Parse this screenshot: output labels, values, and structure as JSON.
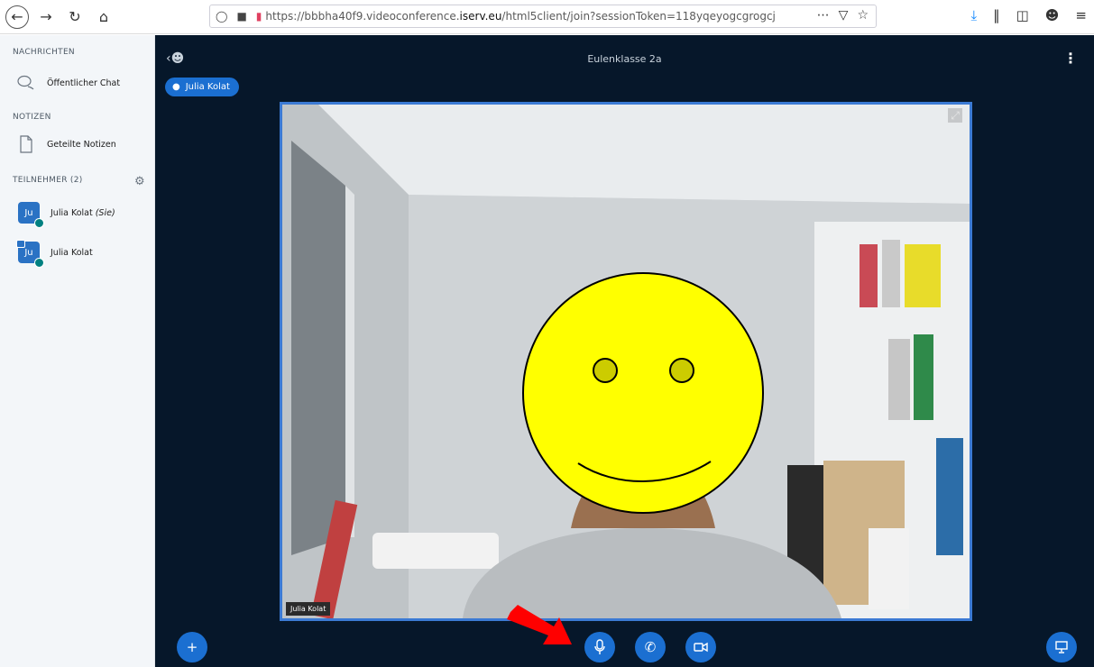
{
  "browser": {
    "url_prefix": "https://bbbha40f9.videoconference.",
    "url_domain": "iserv.eu",
    "url_suffix": "/html5client/join?sessionToken=118yqeyogcgrogcj",
    "icons": [
      "back-icon",
      "forward-icon",
      "reload-icon",
      "home-icon",
      "shield-icon",
      "lock-icon",
      "camera-permission-icon",
      "more-icon",
      "pocket-icon",
      "bookmark-star-icon",
      "download-icon",
      "library-icon",
      "sidebar-icon",
      "account-icon",
      "menu-icon"
    ]
  },
  "sidebar": {
    "messages_title": "NACHRICHTEN",
    "public_chat": "Öffentlicher Chat",
    "notes_title": "NOTIZEN",
    "shared_notes": "Geteilte Notizen",
    "participants_title": "TEILNEHMER (2)",
    "users": [
      {
        "initials": "Ju",
        "name": "Julia Kolat",
        "suffix": " (Sie)"
      },
      {
        "initials": "Ju",
        "name": "Julia Kolat"
      }
    ]
  },
  "main": {
    "meeting_title": "Eulenklasse 2a",
    "talking_user": "Julia Kolat",
    "video_label": "Julia Kolat"
  },
  "colors": {
    "main_bg": "#06172a",
    "accent": "#1b6fd1",
    "sidebar_bg": "#f3f6f9",
    "smiley": "#ffff00"
  }
}
